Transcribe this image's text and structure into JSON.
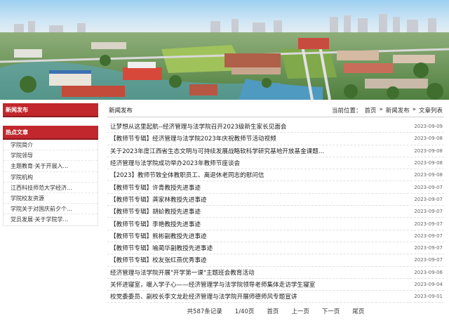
{
  "sidebar": {
    "news_heading": "新闻发布",
    "hot_heading": "热点文章",
    "items": [
      {
        "label": "学院简介"
      },
      {
        "label": "学院领导"
      },
      {
        "label": "主题教育·关于开展入..."
      },
      {
        "label": "学院机构"
      },
      {
        "label": "江西科技师范大学经济..."
      },
      {
        "label": "学院校友资源"
      },
      {
        "label": "学院关于对国庆前夕个..."
      },
      {
        "label": "党员发展·关于学院学..."
      }
    ]
  },
  "main": {
    "title": "新闻发布",
    "breadcrumb": {
      "prefix": "当前位置：",
      "home": "首页",
      "sep1": "»",
      "section": "新闻发布",
      "sep2": "»",
      "current": "文章列表"
    },
    "news": [
      {
        "title": "让梦想从这里起航--经济管理与法学院召开2023级新生家长见面会",
        "date": "2023-09-09"
      },
      {
        "title": "【教师节专辑】经济管理与法学院2023年庆祝教师节活动视频",
        "date": "2023-09-08"
      },
      {
        "title": "关于2023年度江西省生态文明与可持续发展战略软科学研究基地开放基金课题...",
        "date": "2023-09-08"
      },
      {
        "title": "经济管理与法学院成功举办2023年教师节座谈会",
        "date": "2023-09-08"
      },
      {
        "title": "【2023】教师节致全体教职员工、离退休老同志的慰问信",
        "date": "2023-09-08"
      },
      {
        "title": "【教师节专辑】许青教授先进事迹",
        "date": "2023-09-07"
      },
      {
        "title": "【教师节专辑】龚家林教授先进事迹",
        "date": "2023-09-07"
      },
      {
        "title": "【教师节专辑】胡蚧教授先进事迹",
        "date": "2023-09-07"
      },
      {
        "title": "【教师节专辑】李艳教授先进事迹",
        "date": "2023-09-07"
      },
      {
        "title": "【教师节专辑】熊彬副教授先进事迹",
        "date": "2023-09-07"
      },
      {
        "title": "【教师节专辑】喻蔺华副教授先进事迹",
        "date": "2023-09-07"
      },
      {
        "title": "【教师节专辑】校友张红燕优秀事迹",
        "date": "2023-09-07"
      },
      {
        "title": "经济管理与法学院开展\"开学第一课\"主题班会教育活动",
        "date": "2023-09-06"
      },
      {
        "title": "关怀进寝室，暖入学子心——经济管理学与法学院领导老师集体走访学生寝室",
        "date": "2023-09-04"
      },
      {
        "title": "校党委委员、副校长李文龙赴经济管理与法学院开展师德师风专题宣讲",
        "date": "2023-09-01"
      }
    ]
  },
  "pager": {
    "total": "共587条记录",
    "page": "1/40页",
    "first": "首页",
    "prev": "上一页",
    "next": "下一页",
    "last": "尾页"
  },
  "colors": {
    "accent": "#c1272d",
    "sky": "#8fc6ea",
    "water": "#5aa7c9"
  }
}
